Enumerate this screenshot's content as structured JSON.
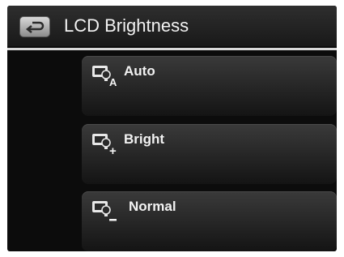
{
  "header": {
    "title": "LCD Brightness",
    "back_icon": "back-arrow-icon"
  },
  "menu": {
    "items": [
      {
        "label": "Auto",
        "icon": "brightness-auto-icon",
        "suffix": "A"
      },
      {
        "label": "Bright",
        "icon": "brightness-bright-icon",
        "suffix": "+"
      },
      {
        "label": "Normal",
        "icon": "brightness-normal-icon",
        "suffix": "_"
      }
    ]
  }
}
